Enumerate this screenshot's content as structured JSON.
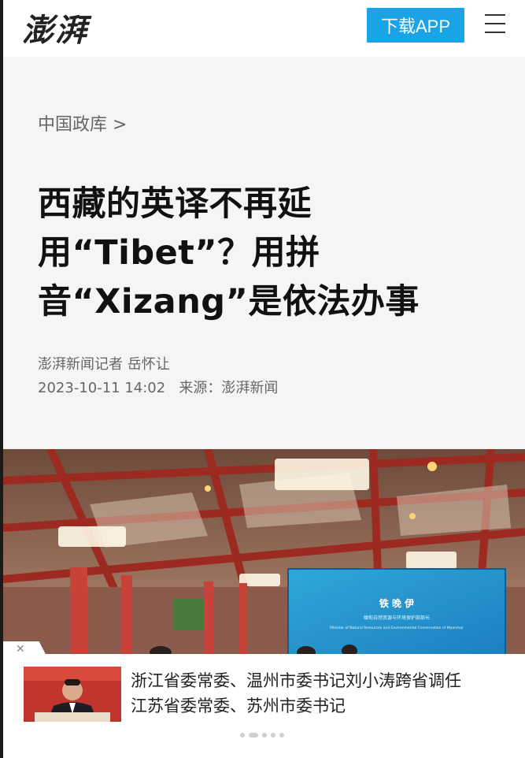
{
  "header": {
    "logo_text": "澎湃",
    "download_label": "下载APP",
    "accent_color": "#18a4e6"
  },
  "article": {
    "breadcrumb": "中国政库 >",
    "title": "西藏的英译不再延用“Tibet”？用拼音“Xizang”是依法办事",
    "author": "澎湃新闻记者 岳怀让",
    "datetime": "2023-10-11 14:02",
    "source": "来源：澎湃新闻"
  },
  "photo": {
    "screen_line1": "铁 晚 伊",
    "screen_line2": "缅甸自然资源与环境保护部部长",
    "screen_line3": "Minister of Natural Resources and Environmental Conservation of Myanmar"
  },
  "recommendation": {
    "text_line1": "浙江省委常委、温州市委书记刘小涛跨省调任",
    "text_line2": "江苏省委常委、苏州市委书记"
  }
}
